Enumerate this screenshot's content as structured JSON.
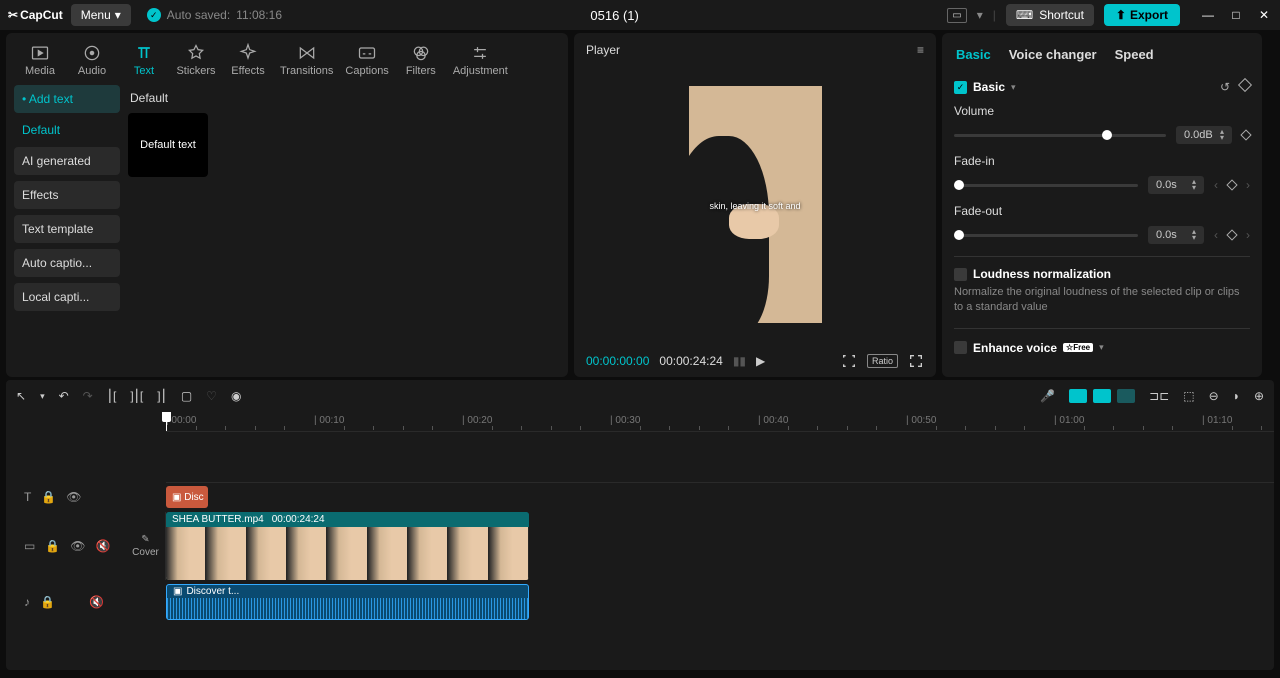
{
  "titlebar": {
    "logo": "CapCut",
    "menu": "Menu",
    "autosave_label": "Auto saved:",
    "autosave_time": "11:08:16",
    "project_name": "0516 (1)",
    "shortcut": "Shortcut",
    "export": "Export"
  },
  "top_tabs": [
    {
      "label": "Media"
    },
    {
      "label": "Audio"
    },
    {
      "label": "Text",
      "active": true
    },
    {
      "label": "Stickers"
    },
    {
      "label": "Effects"
    },
    {
      "label": "Transitions"
    },
    {
      "label": "Captions"
    },
    {
      "label": "Filters"
    },
    {
      "label": "Adjustment"
    }
  ],
  "text_sidebar": {
    "add": "Add text",
    "items": [
      "Default",
      "AI generated",
      "Effects",
      "Text template",
      "Auto captio...",
      "Local capti..."
    ]
  },
  "text_content": {
    "section": "Default",
    "thumb_label": "Default text"
  },
  "player": {
    "title": "Player",
    "caption_overlay": "skin, leaving it soft and",
    "time_current": "00:00:00:00",
    "time_total": "00:00:24:24",
    "ratio": "Ratio"
  },
  "inspector": {
    "tabs": [
      "Basic",
      "Voice changer",
      "Speed"
    ],
    "basic": {
      "title": "Basic",
      "volume_label": "Volume",
      "volume_value": "0.0dB",
      "fadein_label": "Fade-in",
      "fadein_value": "0.0s",
      "fadeout_label": "Fade-out",
      "fadeout_value": "0.0s",
      "loudness_title": "Loudness normalization",
      "loudness_desc": "Normalize the original loudness of the selected clip or clips to a standard value",
      "enhance_title": "Enhance voice",
      "enhance_badge": "Free"
    }
  },
  "ruler_marks": [
    "00:00",
    "00:10",
    "00:20",
    "00:30",
    "00:40",
    "00:50",
    "01:00",
    "01:10"
  ],
  "clips": {
    "text_short": "Disc",
    "video_name": "SHEA BUTTER.mp4",
    "video_dur": "00:00:24:24",
    "audio_name": "Discover t..."
  },
  "cover_label": "Cover"
}
